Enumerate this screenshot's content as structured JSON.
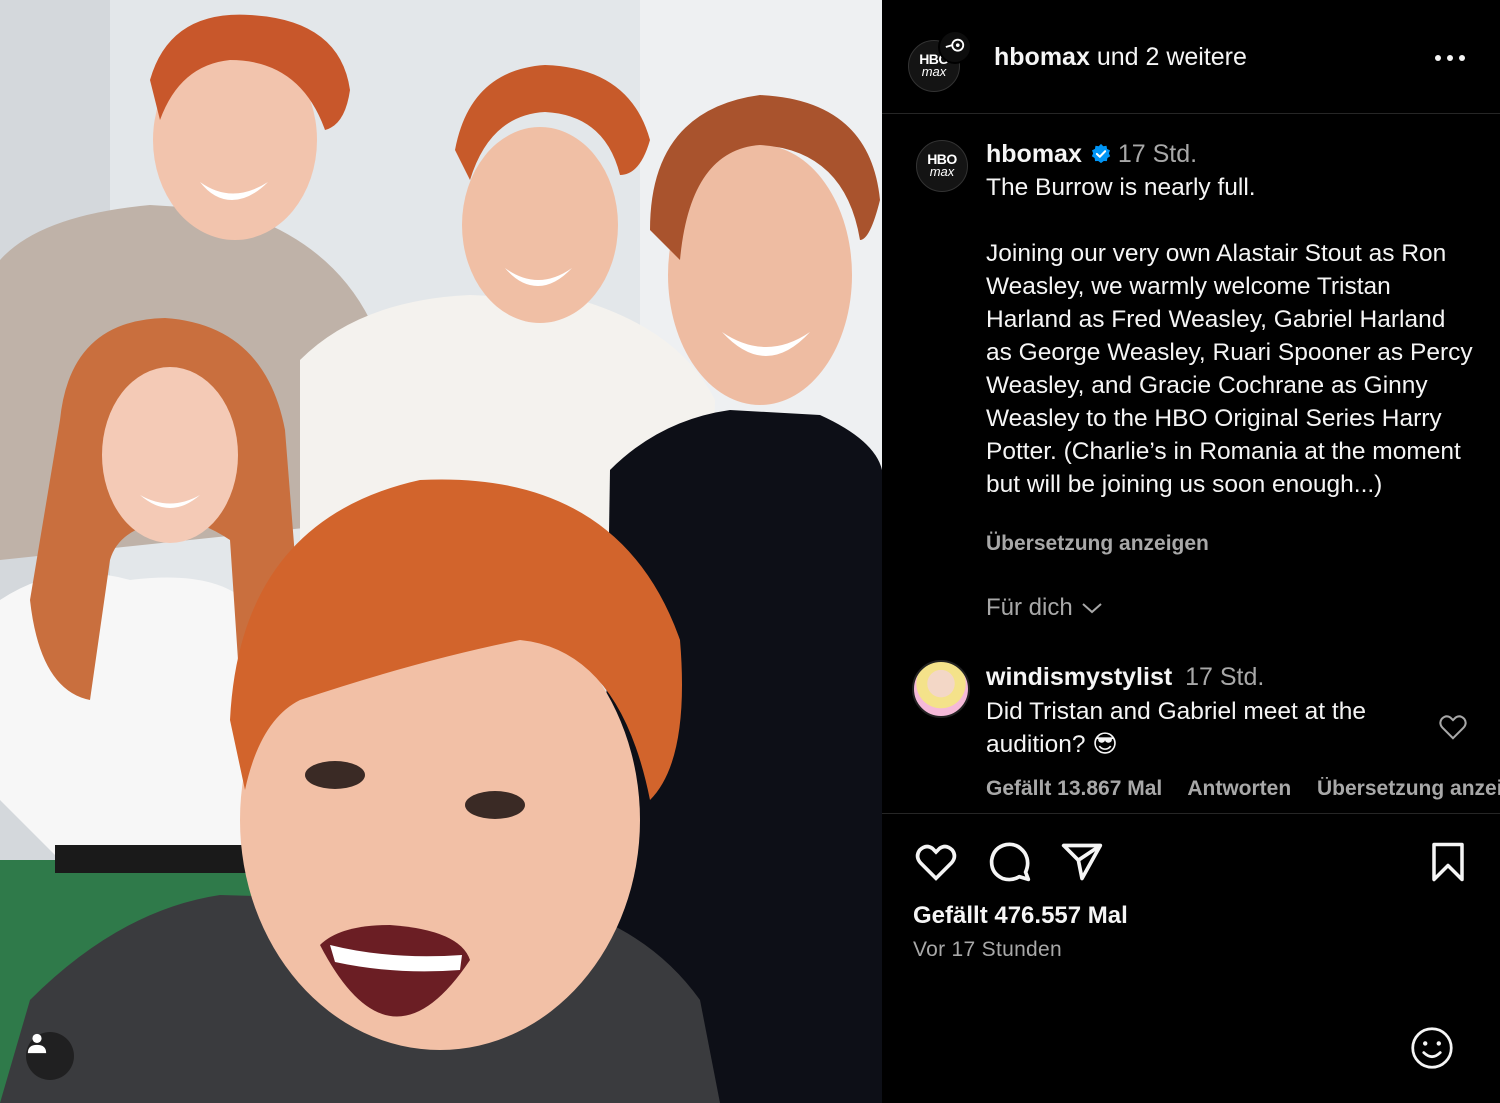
{
  "header": {
    "account": "hbomax",
    "collab_suffix": "und 2 weitere",
    "more_icon": "more-horizontal-icon"
  },
  "avatar": {
    "line1": "HBO",
    "line2": "max"
  },
  "caption": {
    "username": "hbomax",
    "time": "17 Std.",
    "text": "The Burrow is nearly full.\n\nJoining our very own Alastair Stout as Ron Weasley, we warmly welcome Tristan Harland as Fred Weasley, Gabriel Harland as George Weasley, Ruari Spooner as Percy Weasley, and Gracie Cochrane as Ginny Weasley to the HBO Original Series Harry Potter. (Charlie’s in Romania at the moment but will be joining us soon enough...)",
    "see_translation": "Übersetzung anzeigen",
    "for_you": "Für dich"
  },
  "comment": {
    "username": "windismystylist",
    "time": "17 Std.",
    "text": "Did Tristan and Gabriel meet at the audition? 😎",
    "likes": "Gefällt 13.867 Mal",
    "reply": "Antworten",
    "translation": "Übersetzung anzeigen"
  },
  "post": {
    "likes": "Gefällt 476.557 Mal",
    "posted": "Vor 17 Stunden"
  },
  "colors": {
    "background": "#000000",
    "text": "#f5f5f5",
    "secondary": "#a8a8a8",
    "verified": "#0095f6",
    "divider": "#262626"
  }
}
